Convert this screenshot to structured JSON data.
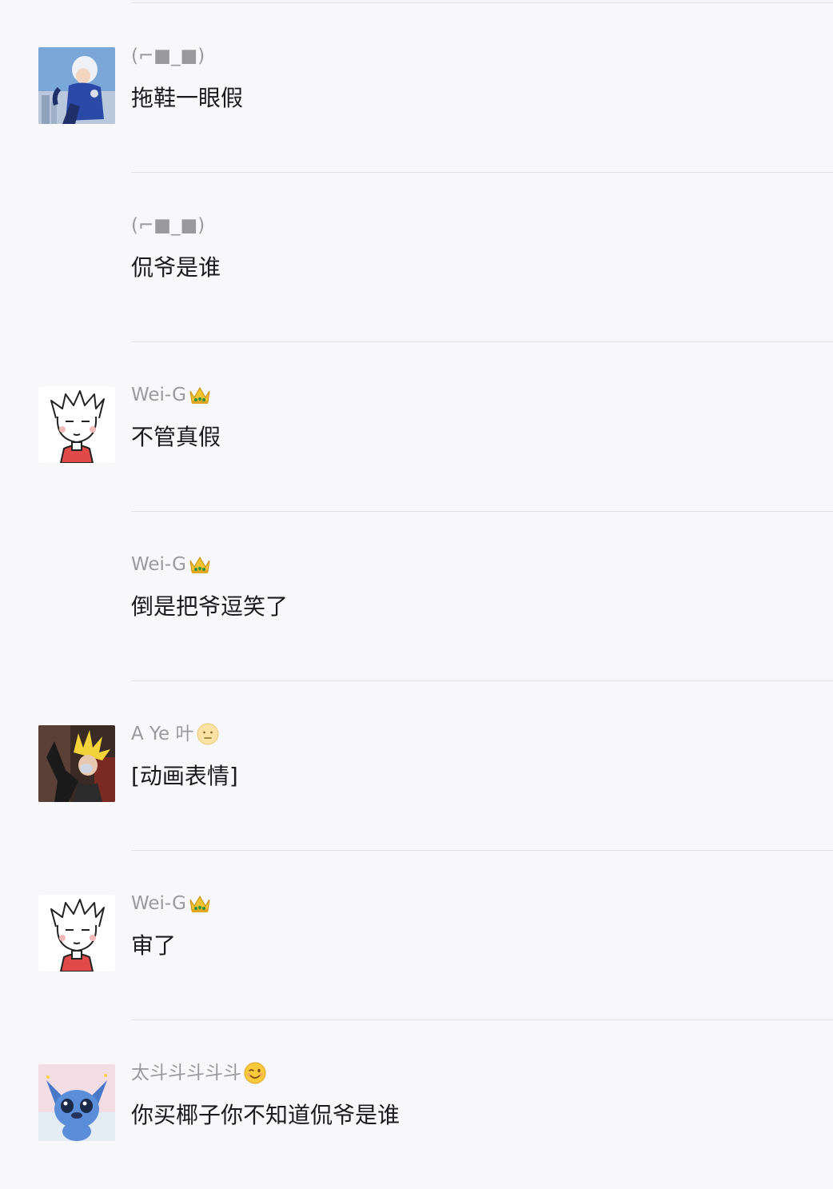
{
  "messages": [
    {
      "sender": "(⌐■_■)",
      "sender_emoji": "",
      "text": "拖鞋一眼假",
      "avatar": "anime-boy-blue-jacket-avatar"
    },
    {
      "sender": "(⌐■_■)",
      "sender_emoji": "",
      "text": "侃爷是谁",
      "avatar": ""
    },
    {
      "sender": "Wei-G",
      "sender_emoji": "crown-icon",
      "text": "不管真假",
      "avatar": "cartoon-boy-red-shirt-avatar"
    },
    {
      "sender": "Wei-G",
      "sender_emoji": "crown-icon",
      "text": "倒是把爷逗笑了",
      "avatar": ""
    },
    {
      "sender": "A Ye 叶",
      "sender_emoji": "neutral-face-icon",
      "text": "[动画表情]",
      "avatar": "super-saiyan-avatar"
    },
    {
      "sender": "Wei-G",
      "sender_emoji": "crown-icon",
      "text": "审了",
      "avatar": "cartoon-boy-red-shirt-avatar"
    },
    {
      "sender": "太斗斗斗斗斗",
      "sender_emoji": "winking-face-icon",
      "text": "你买椰子你不知道侃爷是谁",
      "avatar": "stitch-avatar"
    }
  ],
  "colors": {
    "background": "#f8f8fa",
    "divider": "#e3e3e6",
    "sender_text": "#9a9a9e",
    "message_text": "#1b1b1d"
  }
}
